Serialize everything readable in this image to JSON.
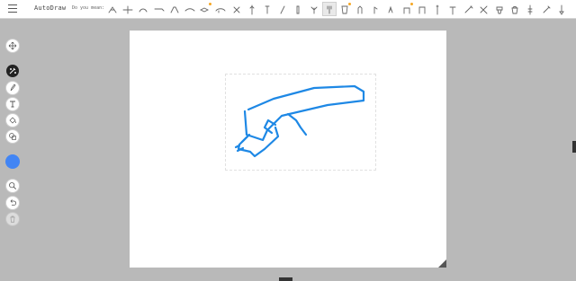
{
  "app": {
    "title": "AutoDraw",
    "suggestion_prompt": "Do you mean:"
  },
  "colors": {
    "accent": "#4285f4",
    "stroke": "#1e88e5",
    "toolbar_bg": "#ffffff",
    "workspace_bg": "#b9b9b9"
  },
  "suggestions": [
    "cricket-icon",
    "dragonfly-icon",
    "snail-icon",
    "scorpion-icon",
    "duck-icon",
    "lizard-icon",
    "fish-icon",
    "whale-icon",
    "fossil-icon",
    "grass-icon",
    "candle-icon",
    "pen-icon",
    "bottle-icon",
    "plant-icon",
    "fork-icon",
    "glass-icon",
    "hand-icon",
    "hand-point-icon",
    "hand-wave-icon",
    "hand-grab-icon",
    "hand-stop-icon",
    "nail-icon",
    "hammer-icon",
    "wrench-icon",
    "tools-icon",
    "toilet-icon",
    "bag-icon",
    "violin-icon",
    "wrench2-icon",
    "shovel-icon"
  ],
  "selected_suggestion": 14,
  "toolbar_tools": [
    {
      "name": "select-tool",
      "icon": "move-icon"
    },
    {
      "name": "autodraw-tool",
      "icon": "autodraw-icon"
    },
    {
      "name": "draw-tool",
      "icon": "pencil-icon"
    },
    {
      "name": "type-tool",
      "icon": "text-icon"
    },
    {
      "name": "fill-tool",
      "icon": "fill-icon"
    },
    {
      "name": "shape-tool",
      "icon": "shape-icon"
    },
    {
      "name": "zoom-tool",
      "icon": "zoom-icon"
    },
    {
      "name": "undo-tool",
      "icon": "undo-icon"
    },
    {
      "name": "delete-tool",
      "icon": "trash-icon"
    }
  ]
}
